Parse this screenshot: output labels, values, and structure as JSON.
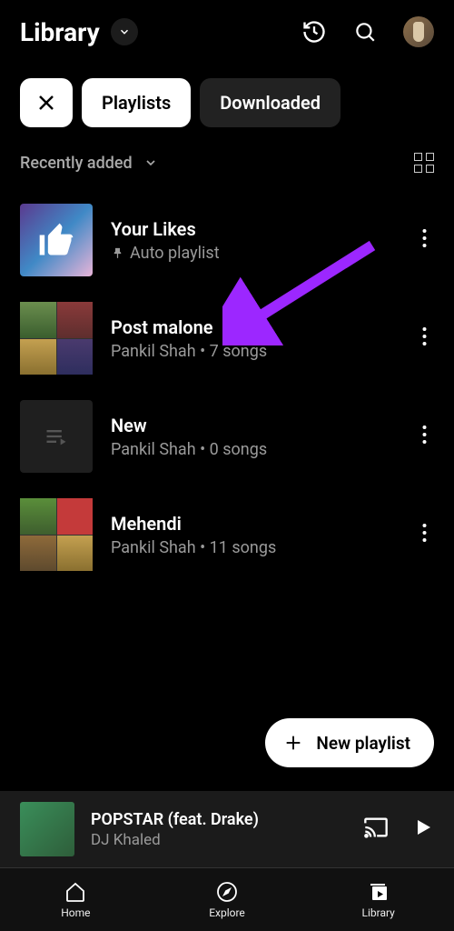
{
  "header": {
    "title": "Library"
  },
  "chips": {
    "active": "Playlists",
    "inactive": "Downloaded"
  },
  "sort": {
    "label": "Recently added"
  },
  "playlists": [
    {
      "title": "Your Likes",
      "subtitle": "Auto playlist",
      "pinned": true
    },
    {
      "title": "Post malone",
      "subtitle": "Pankil Shah • 7 songs"
    },
    {
      "title": "New",
      "subtitle": "Pankil Shah • 0 songs"
    },
    {
      "title": "Mehendi",
      "subtitle": "Pankil Shah • 11 songs"
    }
  ],
  "fab": {
    "label": "New playlist"
  },
  "miniplayer": {
    "title": "POPSTAR (feat. Drake)",
    "artist": "DJ Khaled"
  },
  "nav": {
    "home": "Home",
    "explore": "Explore",
    "library": "Library"
  }
}
